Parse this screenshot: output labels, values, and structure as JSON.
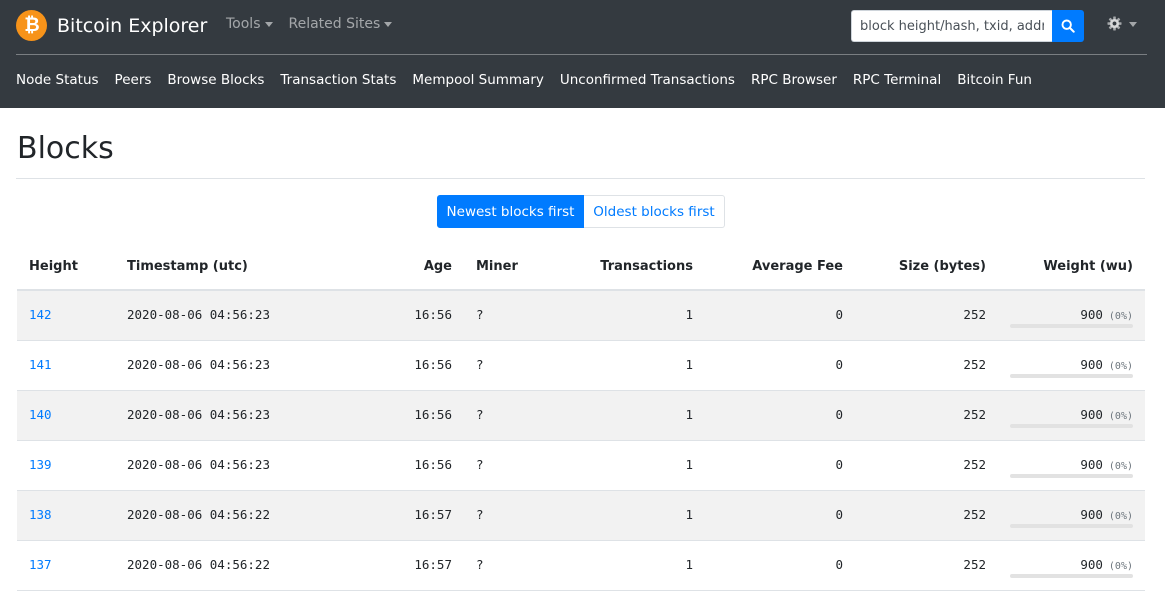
{
  "header": {
    "brand_name": "Bitcoin Explorer",
    "brand_glyph": "₿",
    "menus": [
      "Tools",
      "Related Sites"
    ],
    "search_placeholder": "block height/hash, txid, address",
    "nav": [
      "Node Status",
      "Peers",
      "Browse Blocks",
      "Transaction Stats",
      "Mempool Summary",
      "Unconfirmed Transactions",
      "RPC Browser",
      "RPC Terminal",
      "Bitcoin Fun"
    ]
  },
  "page": {
    "title": "Blocks",
    "sort_newest": "Newest blocks first",
    "sort_oldest": "Oldest blocks first"
  },
  "table": {
    "headers": [
      "Height",
      "Timestamp (utc)",
      "Age",
      "Miner",
      "Transactions",
      "Average Fee",
      "Size (bytes)",
      "Weight (wu)"
    ],
    "rows": [
      {
        "height": "142",
        "timestamp": "2020-08-06 04:56:23",
        "age": "16:56",
        "miner": "?",
        "transactions": "1",
        "avg_fee": "0",
        "size": "252",
        "weight": "900",
        "weight_pct": "(0%)",
        "weight_fill": 0
      },
      {
        "height": "141",
        "timestamp": "2020-08-06 04:56:23",
        "age": "16:56",
        "miner": "?",
        "transactions": "1",
        "avg_fee": "0",
        "size": "252",
        "weight": "900",
        "weight_pct": "(0%)",
        "weight_fill": 0
      },
      {
        "height": "140",
        "timestamp": "2020-08-06 04:56:23",
        "age": "16:56",
        "miner": "?",
        "transactions": "1",
        "avg_fee": "0",
        "size": "252",
        "weight": "900",
        "weight_pct": "(0%)",
        "weight_fill": 0
      },
      {
        "height": "139",
        "timestamp": "2020-08-06 04:56:23",
        "age": "16:56",
        "miner": "?",
        "transactions": "1",
        "avg_fee": "0",
        "size": "252",
        "weight": "900",
        "weight_pct": "(0%)",
        "weight_fill": 0
      },
      {
        "height": "138",
        "timestamp": "2020-08-06 04:56:22",
        "age": "16:57",
        "miner": "?",
        "transactions": "1",
        "avg_fee": "0",
        "size": "252",
        "weight": "900",
        "weight_pct": "(0%)",
        "weight_fill": 0
      },
      {
        "height": "137",
        "timestamp": "2020-08-06 04:56:22",
        "age": "16:57",
        "miner": "?",
        "transactions": "1",
        "avg_fee": "0",
        "size": "252",
        "weight": "900",
        "weight_pct": "(0%)",
        "weight_fill": 0
      }
    ]
  },
  "colors": {
    "navbar": "#343a40",
    "accent": "#007bff",
    "brand": "#f7931a",
    "row_stripe": "#f2f2f2"
  },
  "icons": [
    "bitcoin-logo-icon",
    "search-icon",
    "gear-icon",
    "chevron-down-icon"
  ]
}
